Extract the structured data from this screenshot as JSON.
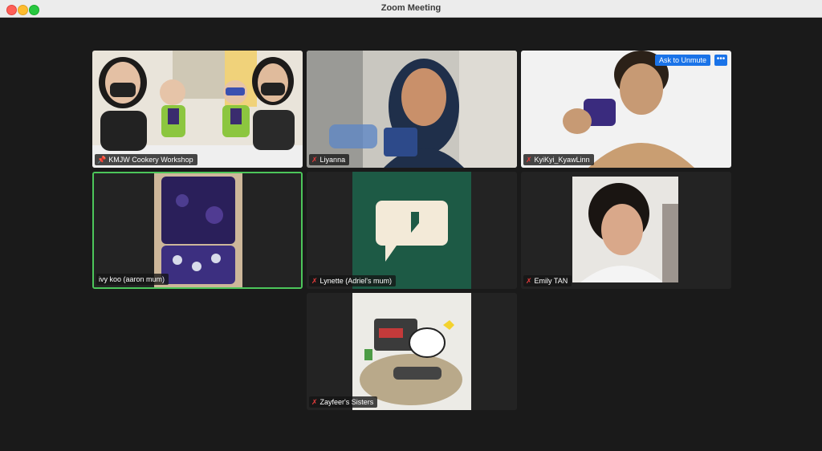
{
  "window": {
    "title": "Zoom Meeting"
  },
  "participants": [
    {
      "name": "KMJW Cookery Workshop",
      "pinned": true,
      "muted": false
    },
    {
      "name": "Liyanna",
      "muted": true
    },
    {
      "name": "KyiKyi_KyawLinn",
      "muted": true
    },
    {
      "name": "ivy koo (aaron mum)",
      "muted": false,
      "speaking": true
    },
    {
      "name": "Lynette (Adriel's mum)",
      "muted": true
    },
    {
      "name": "Emily TAN",
      "muted": true
    },
    {
      "name": "Zayfeer's Sisters",
      "muted": true
    }
  ],
  "controls": {
    "ask_to_unmute": "Ask to Unmute",
    "more": "•••"
  },
  "icons": {
    "muted": "mic-off-icon",
    "pinned": "pin-icon"
  }
}
